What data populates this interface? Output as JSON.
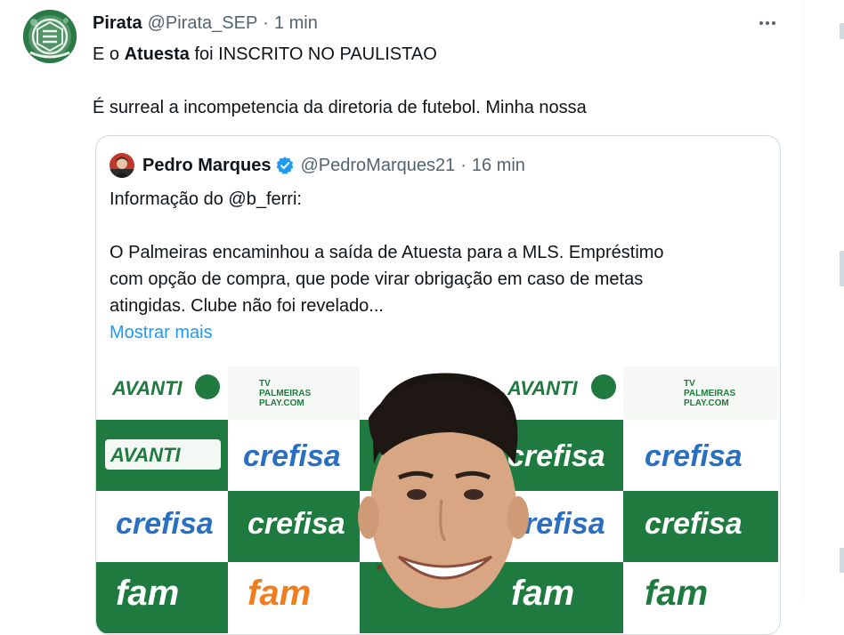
{
  "tweet": {
    "author_name": "Pirata",
    "handle": "@Pirata_SEP",
    "separator": "·",
    "time": "1 min",
    "text_line1_before": "E o ",
    "text_line1_bold": "Atuesta",
    "text_line1_after": " foi INSCRITO NO PAULISTAO",
    "text_line2": "É surreal a incompetencia da diretoria de futebol. Minha nossa"
  },
  "quoted": {
    "author_name": "Pedro Marques",
    "handle": "@PedroMarques21",
    "separator": "·",
    "time": "16 min",
    "line1": "Informação do @b_ferri:",
    "line2": "O Palmeiras encaminhou a saída de Atuesta para a MLS. Empréstimo",
    "line3": "com opção de compra, que pode virar obrigação em caso de metas",
    "line4": "atingidas. Clube não foi revelado...",
    "show_more": "Mostrar mais"
  },
  "backdrop": {
    "sponsor_avanti": "AVANTI",
    "sponsor_crefisa": "crefisa",
    "sponsor_fam": "fam",
    "palmeiras_play_tv": "TV",
    "palmeiras_play": "PALMEIRAS",
    "palmeiras_play_sub": "PLAY.COM"
  },
  "colors": {
    "text_primary": "#0f1419",
    "text_secondary": "#536471",
    "link_blue": "#1d9bf0",
    "border": "#cfd9de",
    "palmeiras_green": "#1f7a3f",
    "crefisa_blue": "#2a6fc0",
    "fam_orange": "#f07d1e"
  },
  "icons": {
    "more": "more-icon",
    "verified": "verified-badge-icon"
  }
}
